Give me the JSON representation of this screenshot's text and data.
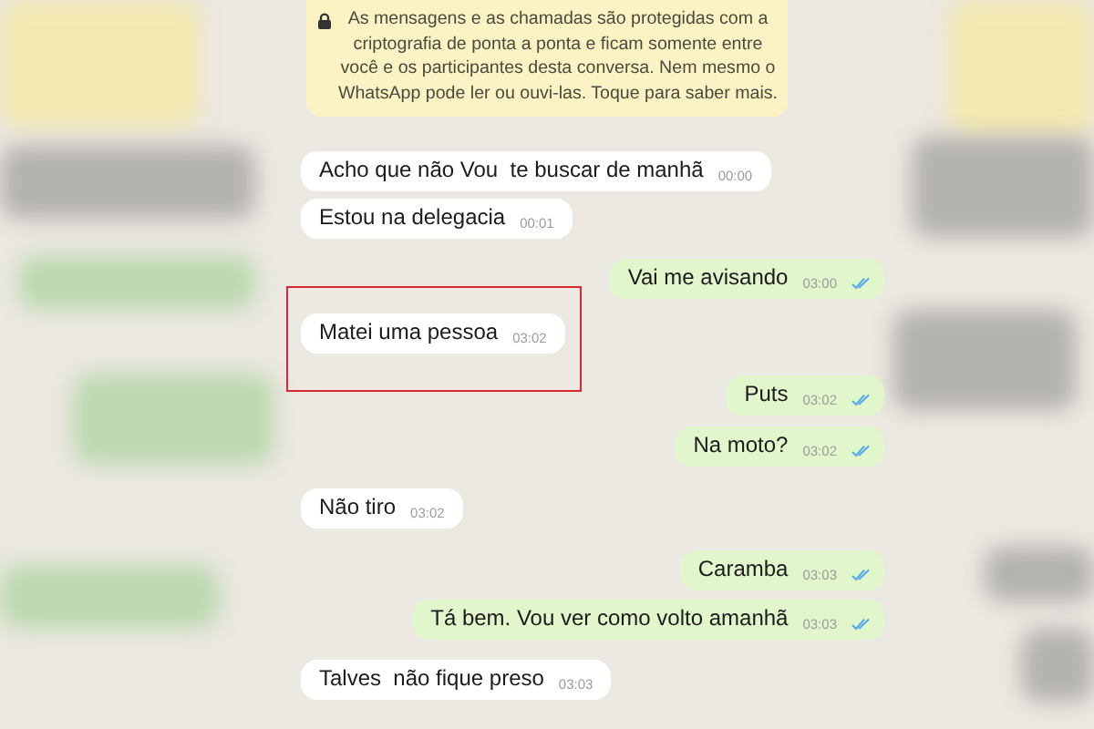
{
  "encryption_notice": {
    "text": "As mensagens e as chamadas são protegidas com a criptografia de ponta a ponta e ficam somente entre você e os participantes desta conversa. Nem mesmo o WhatsApp pode ler ou ouvi-las. Toque para saber mais."
  },
  "messages": [
    {
      "kind": "incoming",
      "text": "Acho que não Vou  te buscar de manhã",
      "time": "00:00",
      "highlighted": false
    },
    {
      "kind": "incoming",
      "text": "Estou na delegacia",
      "time": "00:01",
      "highlighted": false
    },
    {
      "kind": "outgoing",
      "text": "Vai me avisando",
      "time": "03:00",
      "read": true,
      "highlighted": false
    },
    {
      "kind": "incoming",
      "text": "Matei uma pessoa",
      "time": "03:02",
      "highlighted": true
    },
    {
      "kind": "outgoing",
      "text": "Puts",
      "time": "03:02",
      "read": true,
      "highlighted": false
    },
    {
      "kind": "outgoing",
      "text": "Na moto?",
      "time": "03:02",
      "read": true,
      "highlighted": false
    },
    {
      "kind": "incoming",
      "text": "Não tiro",
      "time": "03:02",
      "highlighted": false
    },
    {
      "kind": "outgoing",
      "text": "Caramba",
      "time": "03:03",
      "read": true,
      "highlighted": false
    },
    {
      "kind": "outgoing",
      "text": "Tá bem. Vou ver como volto amanhã",
      "time": "03:03",
      "read": true,
      "highlighted": false
    },
    {
      "kind": "incoming",
      "text": "Talves  não fique preso",
      "time": "03:03",
      "highlighted": false
    }
  ],
  "redactions": [
    {
      "kind": "yellow"
    },
    {
      "kind": "yellow"
    },
    {
      "kind": "grey"
    },
    {
      "kind": "grey"
    },
    {
      "kind": "green"
    },
    {
      "kind": "grey"
    },
    {
      "kind": "green"
    },
    {
      "kind": "green"
    },
    {
      "kind": "grey"
    },
    {
      "kind": "grey"
    }
  ]
}
